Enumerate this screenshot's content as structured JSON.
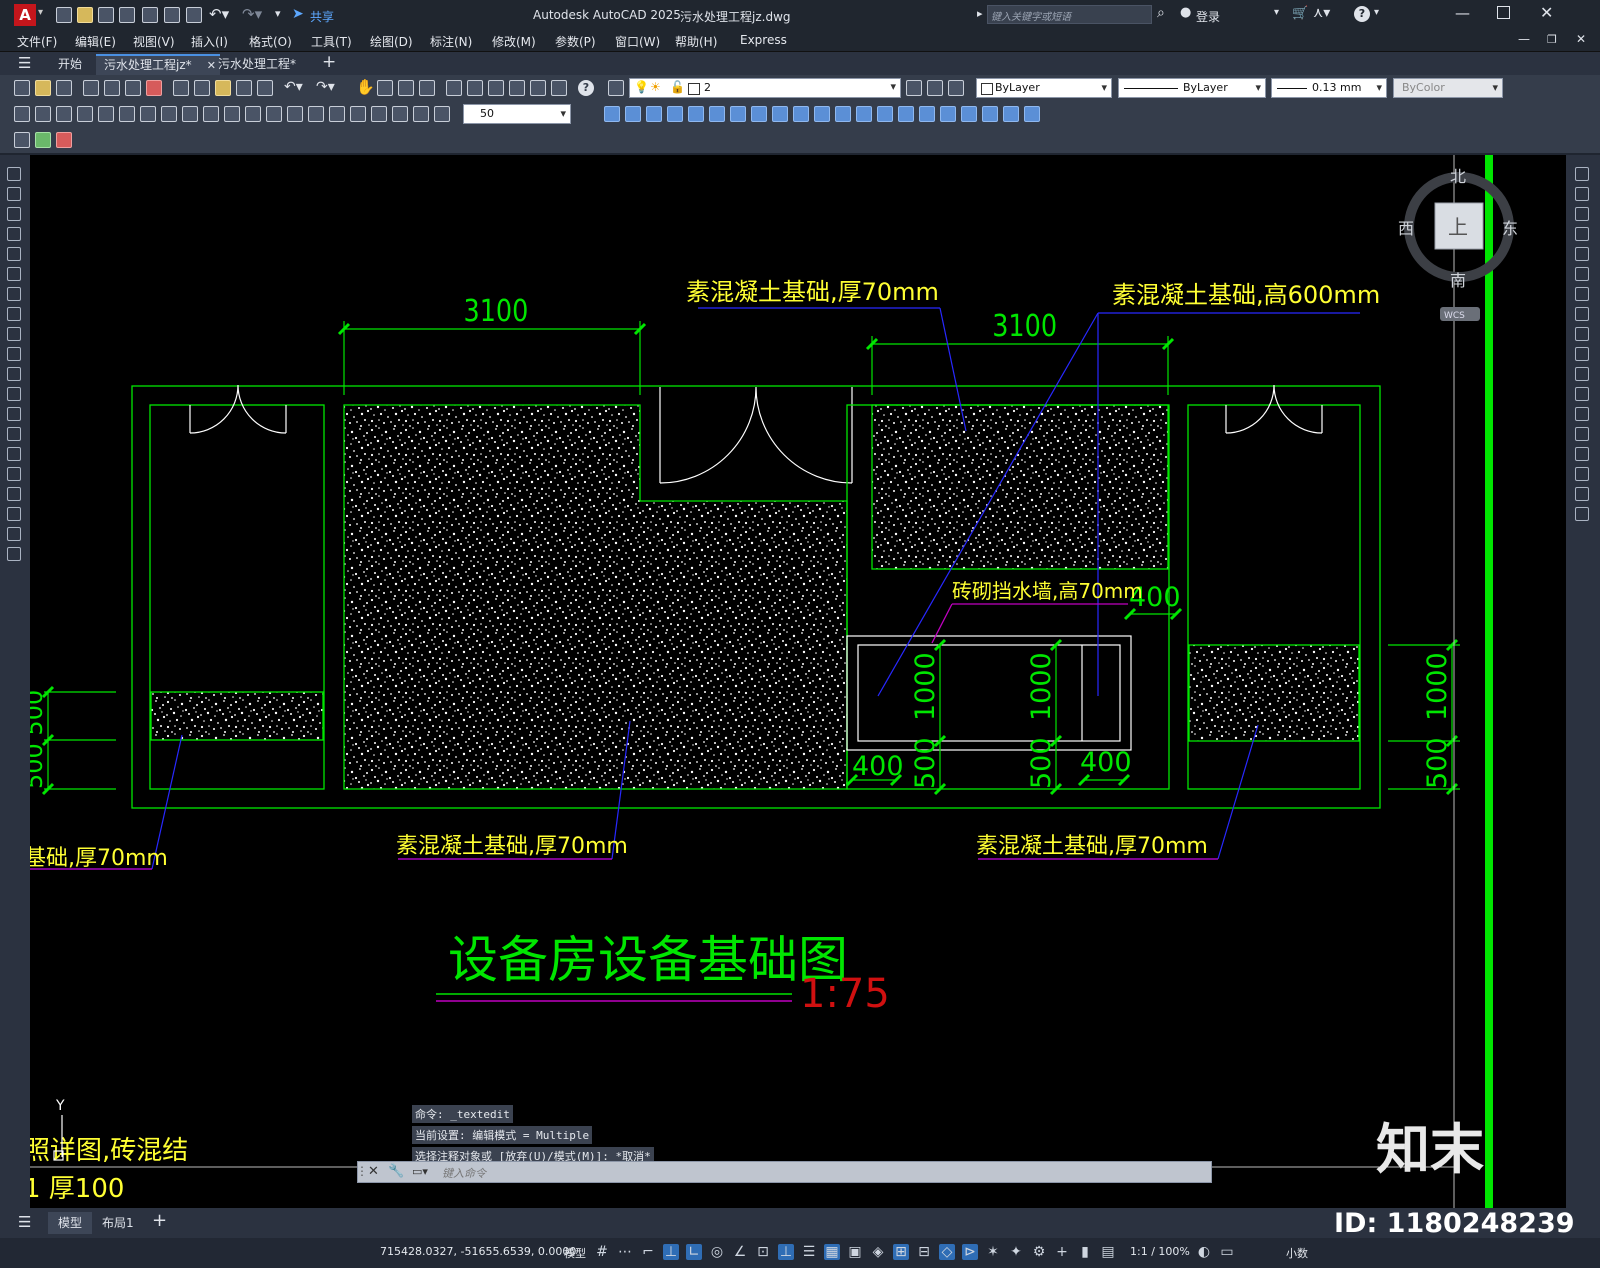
{
  "app": {
    "logo": "A",
    "title": "Autodesk AutoCAD 2025",
    "filename": "污水处理工程jz.dwg",
    "share": "共享",
    "search_placeholder": "键入关键字或短语",
    "login": "登录",
    "window_controls": [
      "minimize-icon",
      "maximize-icon",
      "close-icon"
    ]
  },
  "menu": [
    "文件(F)",
    "编辑(E)",
    "视图(V)",
    "插入(I)",
    "格式(O)",
    "工具(T)",
    "绘图(D)",
    "标注(N)",
    "修改(M)",
    "参数(P)",
    "窗口(W)",
    "帮助(H)",
    "Express"
  ],
  "tabs": [
    {
      "label": "开始",
      "active": false
    },
    {
      "label": "污水处理工程jz*",
      "active": true
    },
    {
      "label": "污水处理工程*",
      "active": false
    }
  ],
  "toolbar": {
    "layer_value": "2",
    "color_value": "ByLayer",
    "linetype_value": "ByLayer",
    "lineweight_value": "0.13 mm",
    "plotstyle_value": "ByColor",
    "dimscale_value": "50"
  },
  "viewcube": {
    "north": "北",
    "south": "南",
    "east": "东",
    "west": "西",
    "face": "上",
    "wcs": "WCS"
  },
  "drawing": {
    "title": "设备房设备基础图",
    "scale": "1:75",
    "labels": {
      "top_left": "素混凝土基础,厚70mm",
      "top_right": "素混凝土基础,高600mm",
      "wall": "砖砌挡水墙,高70mm",
      "bottom_mid": "素混凝土基础,厚70mm",
      "bottom_right": "素混凝土基础,厚70mm",
      "left_partial": "基础,厚70mm",
      "bottom_left_partial_1": "照详图,砖混结",
      "bottom_left_partial_2": "1 厚100"
    },
    "dims": {
      "d3100a": "3100",
      "d3100b": "3100",
      "d400_wall": "400",
      "d1000a": "1000",
      "d1000b": "1000",
      "d1000c": "1000",
      "d400a": "400",
      "d400b": "400",
      "d500a": "500",
      "d500b": "500",
      "d500c": "500",
      "left_partial": "500 500"
    },
    "axis_y": "Y",
    "watermark_brand": "知末",
    "watermark_id": "ID: 1180248239"
  },
  "command": {
    "lines": [
      "命令: _textedit",
      "当前设置: 编辑模式 = Multiple",
      "选择注释对象或 [放弃(U)/模式(M)]: *取消*"
    ],
    "placeholder": "键入命令"
  },
  "layout_tabs": [
    {
      "label": "模型",
      "active": true
    },
    {
      "label": "布局1",
      "active": false
    }
  ],
  "status": {
    "coords": "715428.0327, -51655.6539, 0.0000",
    "model": "模型",
    "zoom": "1:1 / 100%",
    "units": "小数"
  },
  "colors": {
    "dim_green": "#00e600",
    "label_yellow": "#ffff33",
    "leader_blue": "#2828ff",
    "leader_magenta": "#c000c0",
    "scale_red": "#d01010",
    "hatch_white": "#ffffff"
  }
}
